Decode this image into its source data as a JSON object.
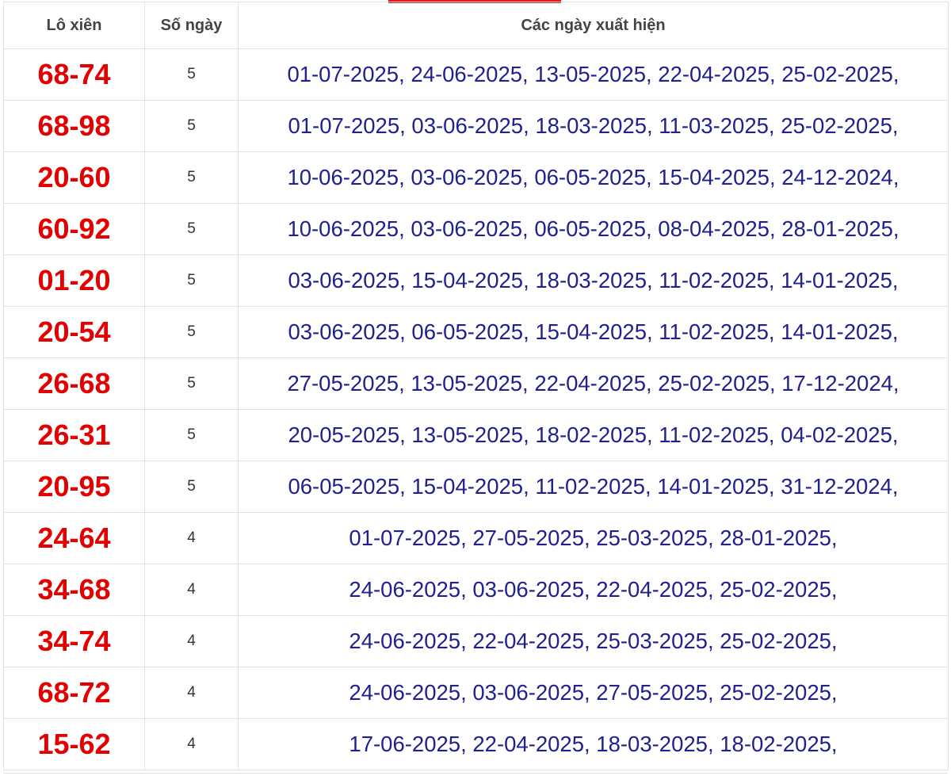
{
  "header": {
    "col_pair": "Lô xiên",
    "col_count": "Số ngày",
    "col_dates": "Các ngày xuất hiện"
  },
  "rows": [
    {
      "pair": "68-74",
      "count": "5",
      "dates": "01-07-2025, 24-06-2025, 13-05-2025, 22-04-2025, 25-02-2025,"
    },
    {
      "pair": "68-98",
      "count": "5",
      "dates": "01-07-2025, 03-06-2025, 18-03-2025, 11-03-2025, 25-02-2025,"
    },
    {
      "pair": "20-60",
      "count": "5",
      "dates": "10-06-2025, 03-06-2025, 06-05-2025, 15-04-2025, 24-12-2024,"
    },
    {
      "pair": "60-92",
      "count": "5",
      "dates": "10-06-2025, 03-06-2025, 06-05-2025, 08-04-2025, 28-01-2025,"
    },
    {
      "pair": "01-20",
      "count": "5",
      "dates": "03-06-2025, 15-04-2025, 18-03-2025, 11-02-2025, 14-01-2025,"
    },
    {
      "pair": "20-54",
      "count": "5",
      "dates": "03-06-2025, 06-05-2025, 15-04-2025, 11-02-2025, 14-01-2025,"
    },
    {
      "pair": "26-68",
      "count": "5",
      "dates": "27-05-2025, 13-05-2025, 22-04-2025, 25-02-2025, 17-12-2024,"
    },
    {
      "pair": "26-31",
      "count": "5",
      "dates": "20-05-2025, 13-05-2025, 18-02-2025, 11-02-2025, 04-02-2025,"
    },
    {
      "pair": "20-95",
      "count": "5",
      "dates": "06-05-2025, 15-04-2025, 11-02-2025, 14-01-2025, 31-12-2024,"
    },
    {
      "pair": "24-64",
      "count": "4",
      "dates": "01-07-2025, 27-05-2025, 25-03-2025, 28-01-2025,"
    },
    {
      "pair": "34-68",
      "count": "4",
      "dates": "24-06-2025, 03-06-2025, 22-04-2025, 25-02-2025,"
    },
    {
      "pair": "34-74",
      "count": "4",
      "dates": "24-06-2025, 22-04-2025, 25-03-2025, 25-02-2025,"
    },
    {
      "pair": "68-72",
      "count": "4",
      "dates": "24-06-2025, 03-06-2025, 27-05-2025, 25-02-2025,"
    },
    {
      "pair": "15-62",
      "count": "4",
      "dates": "17-06-2025, 22-04-2025, 18-03-2025, 18-02-2025,"
    }
  ],
  "colors": {
    "pair_text": "#e30000",
    "dates_text": "#20208f",
    "accent": "#e01b1b",
    "border": "#e2e2e2"
  }
}
